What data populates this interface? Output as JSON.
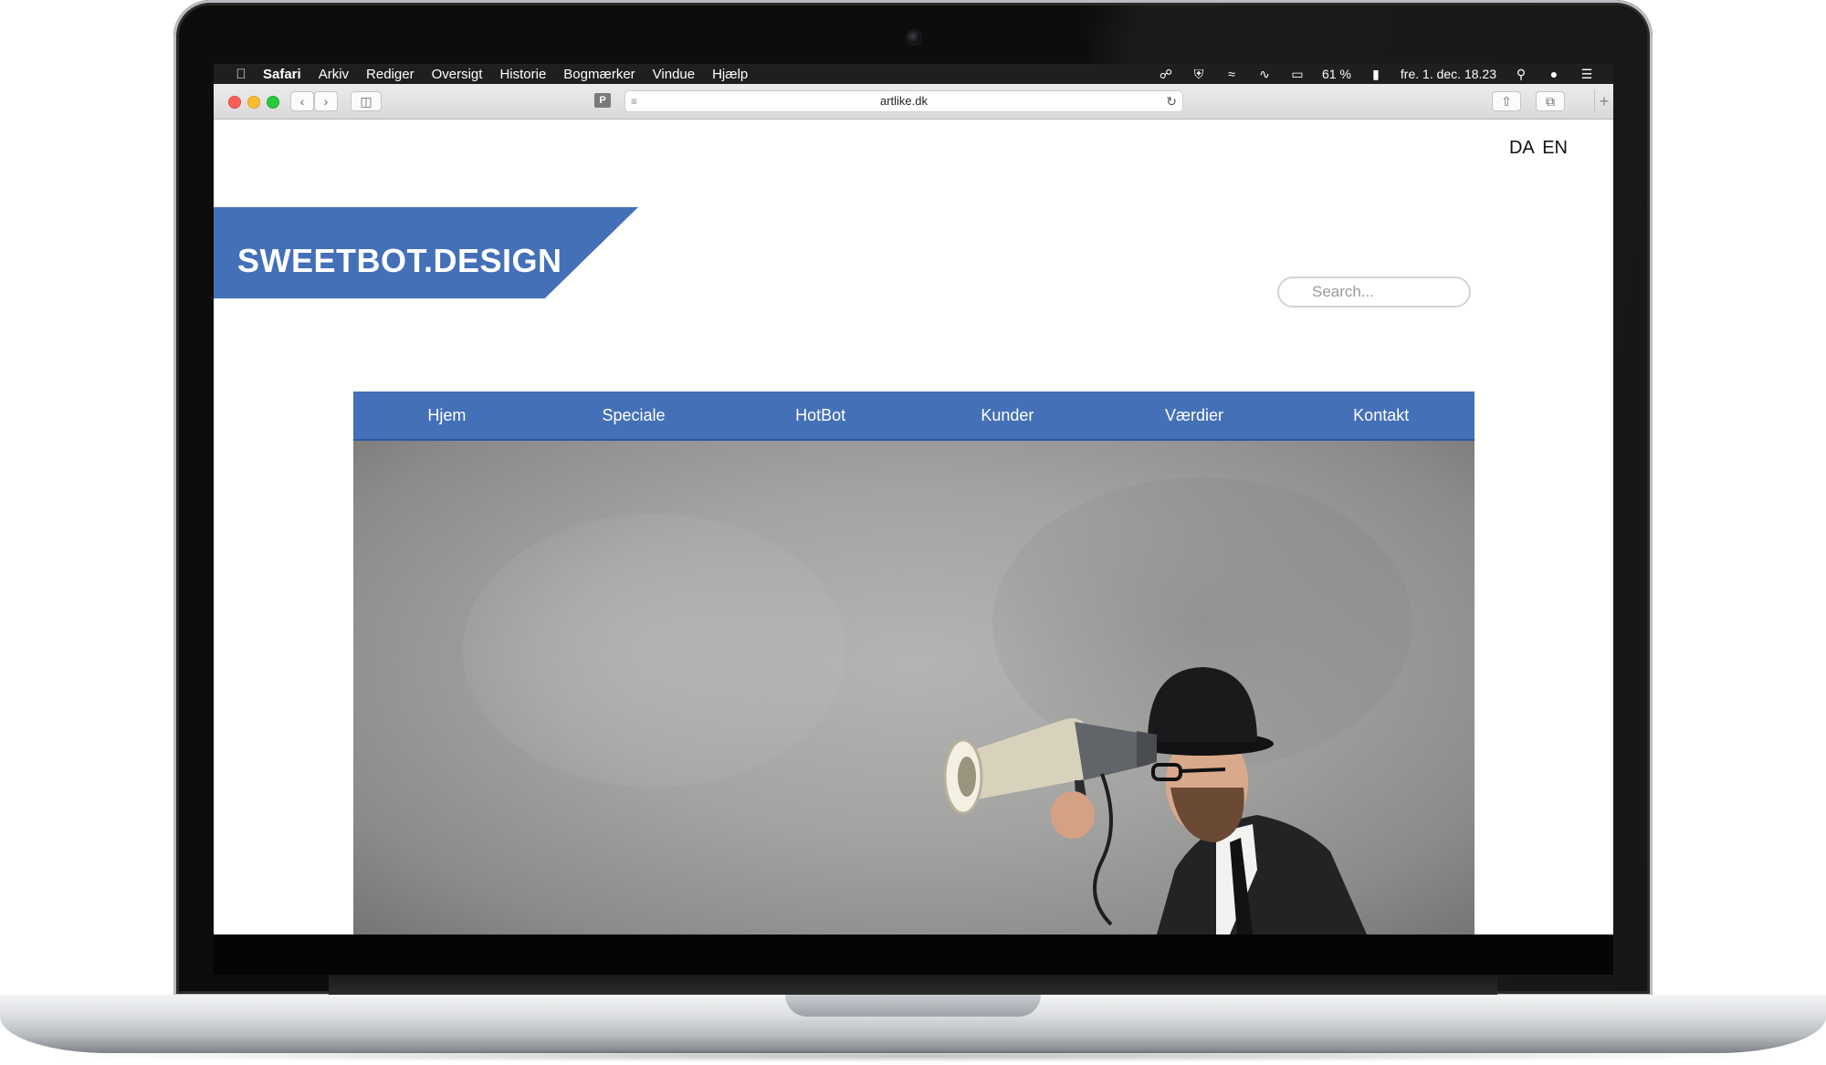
{
  "menubar": {
    "app": "Safari",
    "items": [
      "Arkiv",
      "Rediger",
      "Oversigt",
      "Historie",
      "Bogmærker",
      "Vindue",
      "Hjælp"
    ],
    "battery": "61 %",
    "clock": "fre. 1. dec.  18.23"
  },
  "browser": {
    "url": "artlike.dk",
    "reader_button": "P"
  },
  "page": {
    "lang_da": "DA",
    "lang_en": "EN",
    "logo": "SWEETBOT.DESIGN",
    "search_placeholder": "Search...",
    "nav": [
      "Hjem",
      "Speciale",
      "HotBot",
      "Kunder",
      "Værdier",
      "Kontakt"
    ]
  },
  "colors": {
    "brand_blue": "#4470b8",
    "menubar": "#1f1f1f"
  }
}
